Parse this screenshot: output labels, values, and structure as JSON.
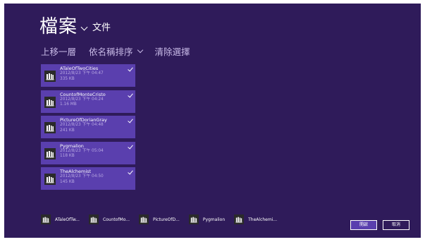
{
  "header": {
    "title": "檔案",
    "subtitle": "文件"
  },
  "commands": {
    "up": "上移一層",
    "sort": "依名稱排序",
    "clear": "清除選擇"
  },
  "files": [
    {
      "name": "ATaleOfTwoCities",
      "date": "2012/8/23 下午 04:47",
      "size": "335 KB",
      "selected": true
    },
    {
      "name": "CountofMonteCristo",
      "date": "2012/8/23 下午 04:24",
      "size": "1.16 MB",
      "selected": true
    },
    {
      "name": "PictureOfDorianGray",
      "date": "2012/8/23 下午 04:48",
      "size": "241 KB",
      "selected": true
    },
    {
      "name": "Pygmalion",
      "date": "2012/8/23 下午 05:04",
      "size": "118 KB",
      "selected": true
    },
    {
      "name": "TheAlchemist",
      "date": "2012/8/23 下午 04:50",
      "size": "145 KB",
      "selected": true
    }
  ],
  "basket": [
    {
      "label": "ATaleOfTw..."
    },
    {
      "label": "CountofMo..."
    },
    {
      "label": "PictureOfD..."
    },
    {
      "label": "Pygmalion"
    },
    {
      "label": "TheAlchemi..."
    }
  ],
  "buttons": {
    "open": "開啟",
    "cancel": "取消"
  },
  "icons": {
    "file": "library-books-icon",
    "check": "checkmark-icon"
  },
  "colors": {
    "background": "#2f1b5a",
    "tile": "#5a3fae",
    "icon_bg": "#2a2a2a"
  }
}
